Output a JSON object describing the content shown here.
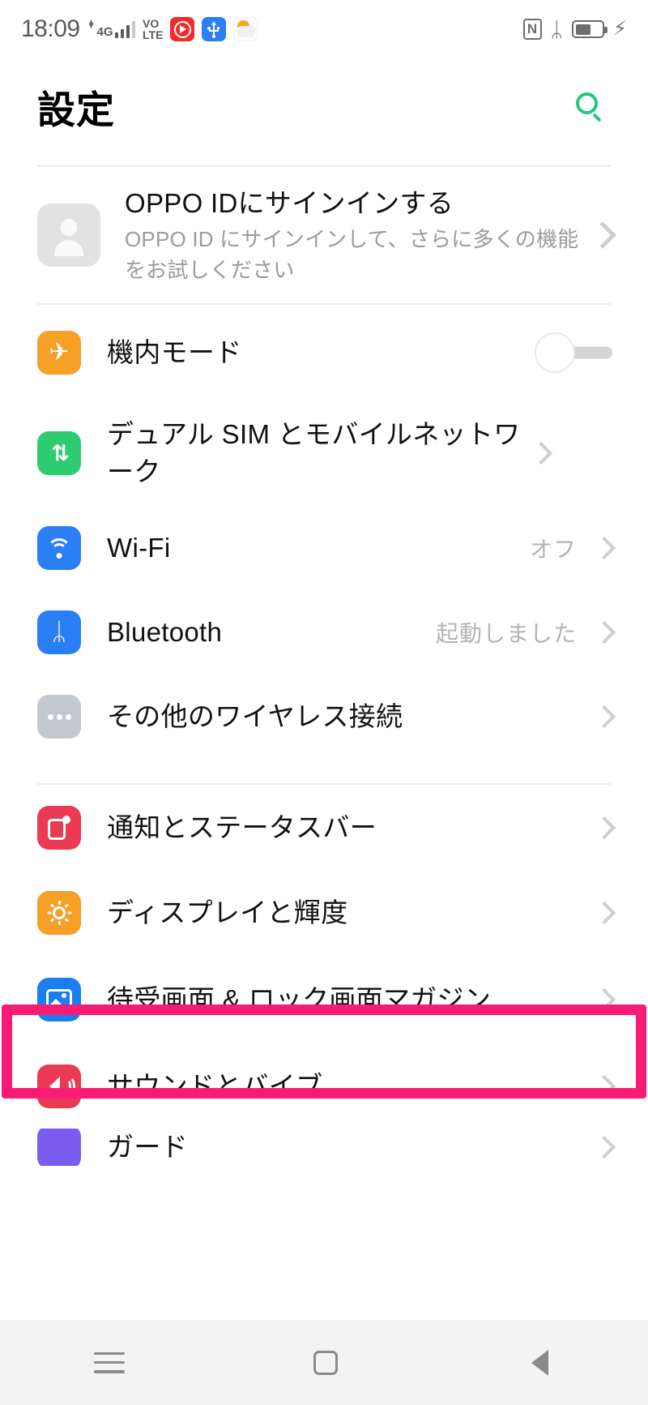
{
  "status_bar": {
    "time": "18:09",
    "network_type": "4G",
    "volte_line1": "VO",
    "volte_line2": "LTE",
    "icons_left": [
      "data-arrows-icon",
      "signal-bars-icon",
      "volte-icon",
      "youtube-music-icon",
      "usb-icon",
      "weather-icon"
    ],
    "icons_right": [
      "nfc-icon",
      "bluetooth-icon",
      "battery-icon",
      "charging-bolt-icon"
    ],
    "bluetooth_glyph": "ᛦ",
    "charging_glyph": "⚡",
    "battery_level_percent": 60
  },
  "header": {
    "title": "設定",
    "search_icon": "search-icon",
    "accent_color": "#25c87b"
  },
  "account": {
    "title": "OPPO IDにサインインする",
    "subtitle": "OPPO ID にサインインして、さらに多くの機能をお試しください",
    "avatar_icon": "avatar-icon"
  },
  "sections": [
    {
      "name": "connectivity",
      "rows": [
        {
          "label": "機内モード",
          "icon": "airplane-icon",
          "icon_color": "#f7a028",
          "icon_glyph": "✈",
          "control": "toggle",
          "toggle_on": false
        },
        {
          "label": "デュアル SIM とモバイルネットワーク",
          "icon": "sim-network-icon",
          "icon_color": "#2ecc71",
          "icon_glyph": "⇅",
          "control": "chevron",
          "value": ""
        },
        {
          "label": "Wi-Fi",
          "icon": "wifi-icon",
          "icon_color": "#2b7ff5",
          "control": "chevron",
          "value": "オフ"
        },
        {
          "label": "Bluetooth",
          "icon": "bluetooth-icon",
          "icon_color": "#2b7ff5",
          "icon_glyph": "ᛦ",
          "control": "chevron",
          "value": "起動しました"
        },
        {
          "label": "その他のワイヤレス接続",
          "icon": "more-wireless-icon",
          "icon_color": "#c4c8cf",
          "control": "chevron",
          "value": ""
        }
      ]
    },
    {
      "name": "device",
      "rows": [
        {
          "label": "通知とステータスバー",
          "icon": "notification-icon",
          "icon_color": "#ea3a54",
          "control": "chevron",
          "value": ""
        },
        {
          "label": "ディスプレイと輝度",
          "icon": "brightness-icon",
          "icon_color": "#f7a028",
          "control": "chevron",
          "value": ""
        },
        {
          "label": "待受画面 & ロック画面マガジン",
          "icon": "wallpaper-icon",
          "icon_color": "#1a7ef0",
          "control": "chevron",
          "value": "",
          "highlighted": true
        },
        {
          "label": "サウンドとバイブ",
          "icon": "sound-vibration-icon",
          "icon_color": "#ea3a54",
          "control": "chevron",
          "value": ""
        }
      ]
    }
  ],
  "annotation": {
    "type": "highlight-box",
    "color": "#f81b75",
    "target": "待受画面 & ロック画面マガジン"
  },
  "navigation_bar": {
    "items": [
      {
        "name": "recents-button",
        "icon": "menu-icon"
      },
      {
        "name": "home-button",
        "icon": "square-icon"
      },
      {
        "name": "back-button",
        "icon": "triangle-back-icon"
      }
    ]
  }
}
